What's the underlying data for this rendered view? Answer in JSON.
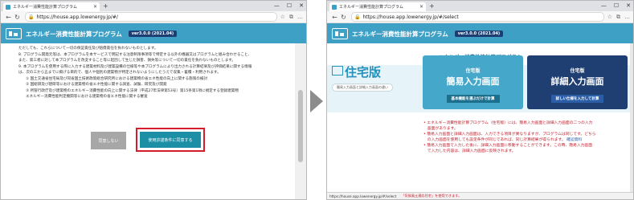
{
  "left": {
    "tab_title": "エネルギー消費性能計算プログラム",
    "url": "https://house.app.lowenergy.jp/#/",
    "app_title": "エネルギー消費性能計算プログラム",
    "version": "ver3.0.0 (2021.04)",
    "terms": [
      "ただしても、これらについて一切の保証責任及び賠償責任を負わないものとします。",
      "8. プログラム開発元等は、本プログラムを本サービスで明記する注意制限事項等で特定する以外の機器又はプログラムと組み合わせること、",
      "また、第三者に対して本プログラムを改変すること等に起因して生じた損害、損失等について一切の責任を負わないものとします。",
      "9. 本プログラムを使用する際に入力する建築材料及び建築設備の仕様等や本プログラムにより出力される計算結果及び評価結果に関する情報",
      "は、次の三から五までに掲げる目的で、個人や個別の建築物が特定されないようにしたうえで収集・蓄積・利用されます。",
      "① 国土交通省住宅局及び同省国土技術政策総合研究所における建築物の省エネ性能の向上に関する施策の検討",
      "② 国総研及び建研等における建築物の省エネ性能に関する調査、試験、研究及び開発",
      "③ 所管行政庁及び建築物のエネルギー消費性能の向上に関する法律（平成27年法律第53号）第15条第1項に規定する登録建築物",
      "エネルギー消費性能判定機関等における建築物の省エネ性能に関する審査"
    ],
    "btn_disagree": "同意しない",
    "btn_agree": "使用許諾条件に同意する"
  },
  "right": {
    "tab_title": "エネルギー消費性能計算プログラム",
    "url": "https://house.app.lowenergy.jp/#/select",
    "app_title": "エネルギー消費性能計算プログラム",
    "version": "ver3.0.0 (2021.04)",
    "subtitle": "エネルギー消費性能計算プログラム",
    "big_title": "住宅版",
    "diff_link": "簡易入力画面と詳細入力画面の違い",
    "simple": {
      "edition": "住宅版",
      "name": "簡易入力画面",
      "action": "基本機能を選ぶだけで計算"
    },
    "detail": {
      "edition": "住宅版",
      "name": "詳細入力画面",
      "action": "詳しい仕様を入力して計算"
    },
    "notes": [
      "• エネルギー消費性能計算プログラム（住宅版）には、簡易入力画面と詳細入力画面の二つの入力",
      "　画面があります。",
      "• 簡易入力画面と詳細入力画面は、入力できる項目が異なりますが、プログラムは同じです。どちら",
      "　の入力画面を使用しても設定条件が同じであれば、同じ計算結果が得られます。",
      "• 簡易入力画面で入力した後に、詳細入力画面に移動することができます。この時、簡易入力画面",
      "　で入力した内容は、詳細入力画面に反映されます。"
    ],
    "memo_label": "確認資料",
    "status_url": "https://house.app.lowenergy.jp/#/select",
    "status_note": "「気候風土適応住宅」を使用できます。"
  }
}
